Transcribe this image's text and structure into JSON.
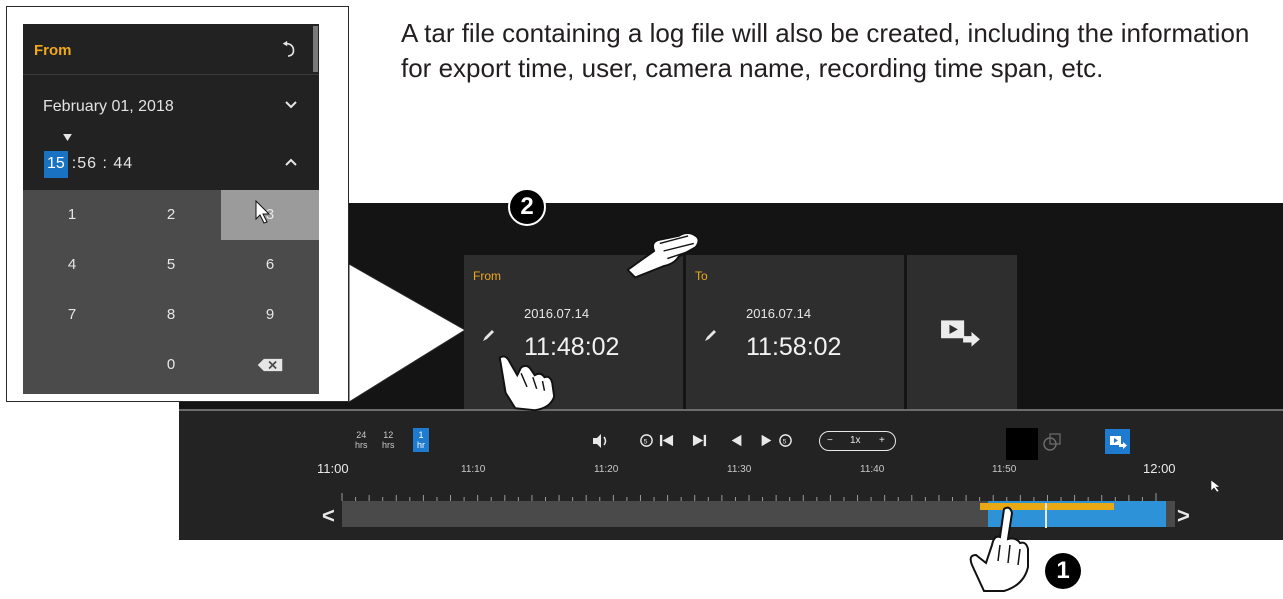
{
  "description": "A tar file containing a log file will also be created, including the information for export time, user, camera name, recording time span, etc.",
  "from_card": {
    "title": "From",
    "date": "2016.07.14",
    "time": "11:48:02"
  },
  "to_card": {
    "title": "To",
    "date": "2016.07.14",
    "time": "11:58:02"
  },
  "time_scales": [
    {
      "line1": "24",
      "line2": "hrs"
    },
    {
      "line1": "12",
      "line2": "hrs"
    },
    {
      "line1": "1",
      "line2": "hr"
    }
  ],
  "speed": {
    "minus": "−",
    "value": "1x",
    "plus": "+"
  },
  "timeline": {
    "major_start": "11:00",
    "ticks": [
      "11:10",
      "11:20",
      "11:30",
      "11:40",
      "11:50"
    ],
    "major_end": "12:00"
  },
  "popup": {
    "title": "From",
    "date": "February 01, 2018",
    "time_hour": "15",
    "time_rest": ":56 : 44",
    "keys": [
      "1",
      "2",
      "3",
      "4",
      "5",
      "6",
      "7",
      "8",
      "9",
      "0"
    ]
  },
  "callouts": {
    "one": "1",
    "two": "2"
  },
  "colors": {
    "accent_blue": "#2d92d8",
    "accent_orange": "#e9a914"
  },
  "icons": [
    "pencil-icon",
    "export-icon",
    "volume-icon",
    "undo-icon",
    "backspace-icon",
    "hand-pointer-icon",
    "mouse-cursor-icon"
  ]
}
